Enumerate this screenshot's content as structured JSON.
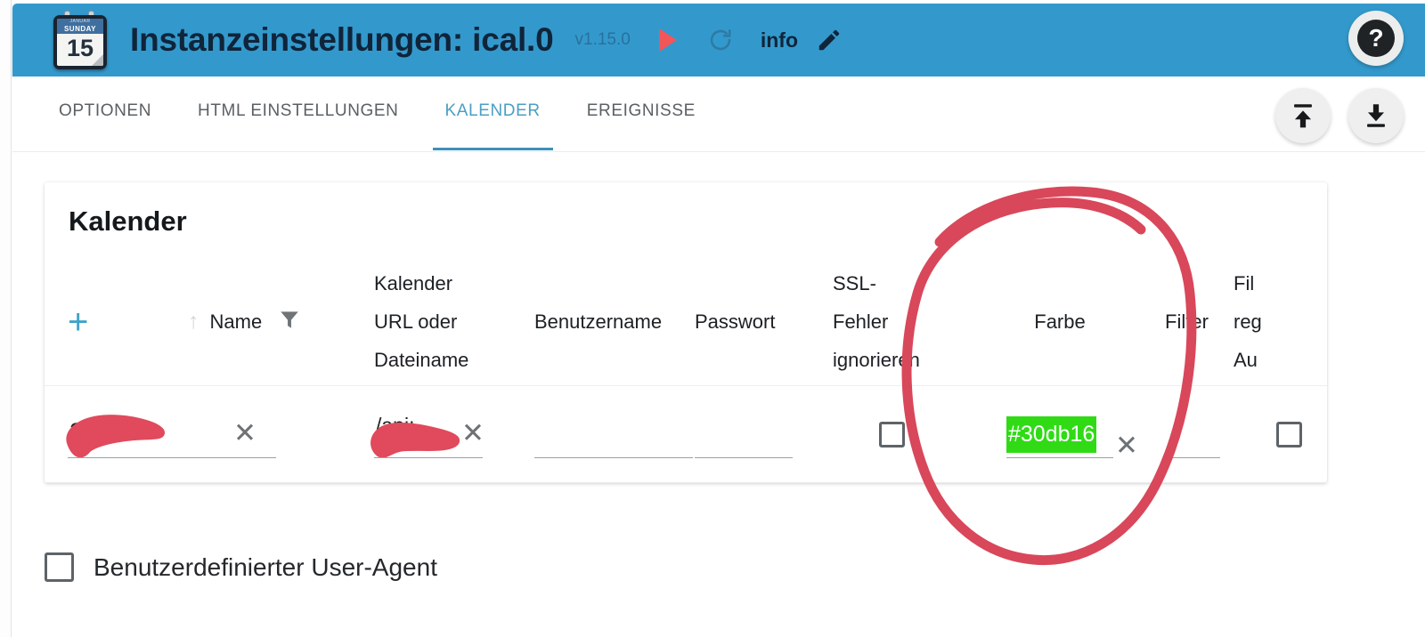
{
  "header": {
    "title": "Instanzeinstellungen: ical.0",
    "version": "v1.15.0",
    "info_label": "info",
    "help_label": "?",
    "icons": {
      "app": "calendar-icon",
      "start": "play-icon",
      "refresh": "refresh-icon",
      "edit": "pencil-icon",
      "help": "help-icon"
    },
    "calendar_icon": {
      "month": "JANUAR",
      "weekday": "SUNDAY",
      "day": "15"
    },
    "colors": {
      "header_bg": "#3399cc",
      "title_text": "#10243a",
      "version_text": "#2a6f9e",
      "play": "#f2555a"
    }
  },
  "tabs": [
    {
      "label": "OPTIONEN",
      "active": false
    },
    {
      "label": "HTML EINSTELLUNGEN",
      "active": false
    },
    {
      "label": "KALENDER",
      "active": true
    },
    {
      "label": "EREIGNISSE",
      "active": false
    }
  ],
  "toolbar": {
    "upload_label": "upload-icon",
    "download_label": "download-icon"
  },
  "card": {
    "title": "Kalender",
    "add_button": "+",
    "sort_arrow": "↑",
    "filter_icon": "filter-funnel-icon",
    "columns": [
      "Name",
      "Kalender URL oder Dateiname",
      "Benutzername",
      "Passwort",
      "SSL-Fehler ignorieren",
      "Farbe",
      "Filter",
      "Filter regulärer Ausdruck"
    ],
    "column_lines": {
      "url": [
        "Kalender",
        "URL oder",
        "Dateiname"
      ],
      "ssl": [
        "SSL-",
        "Fehler",
        "ignorieren"
      ],
      "regex": [
        "Fil",
        "reg",
        "Au"
      ]
    },
    "rows": [
      {
        "name": "",
        "name_redacted": true,
        "url": "",
        "url_redacted": true,
        "username": "",
        "password": "",
        "ssl_ignore": false,
        "color": "#30db16",
        "filter": "",
        "filter_regex": false,
        "clear_label": "✕"
      }
    ]
  },
  "footer": {
    "user_agent_label": "Benutzerdefinierter User-Agent",
    "user_agent_checked": false
  },
  "annotation": {
    "type": "hand-drawn-circle",
    "target": "Farbe",
    "color": "#d9475a"
  }
}
